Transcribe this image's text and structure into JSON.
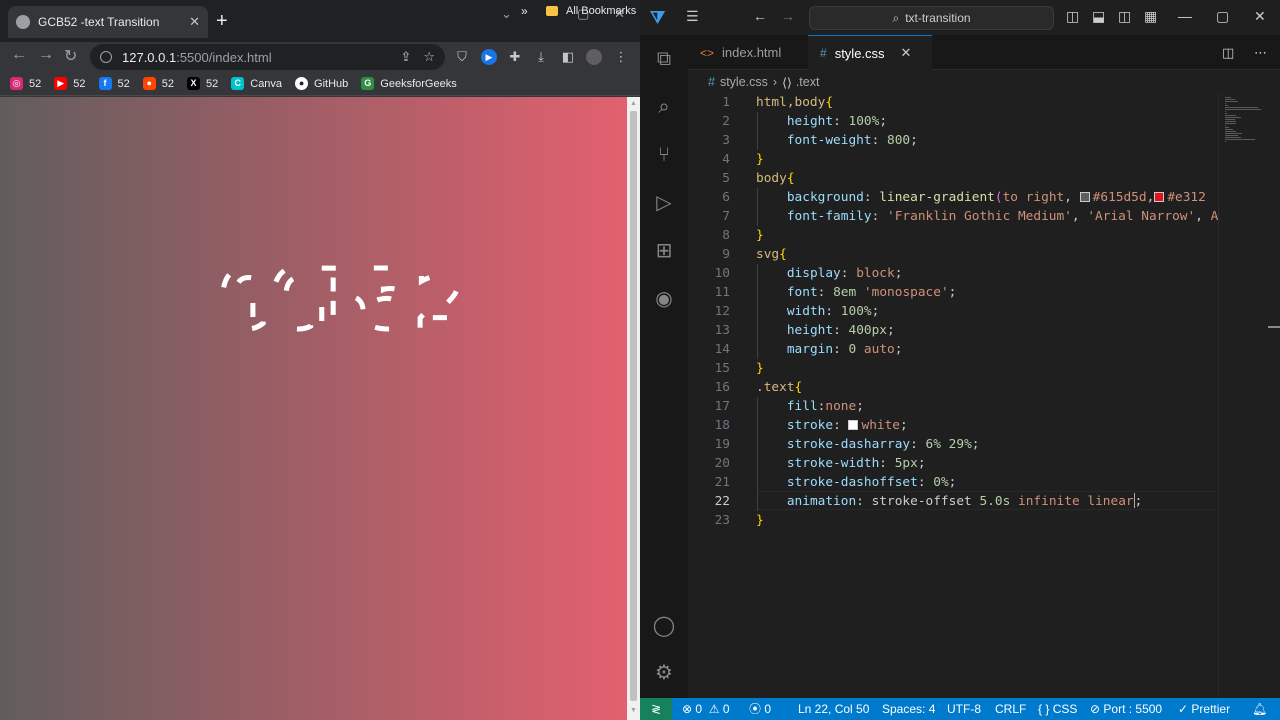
{
  "browser": {
    "tab_title": "GCB52 -text Transition",
    "url_host": "127.0.0.1",
    "url_rest": ":5500/index.html",
    "bookmarks": [
      {
        "icon": "instagram-icon",
        "label": "52",
        "color": "#d62976"
      },
      {
        "icon": "youtube-icon",
        "label": "52",
        "color": "#ff0000"
      },
      {
        "icon": "facebook-icon",
        "label": "52",
        "color": "#1877f2"
      },
      {
        "icon": "reddit-icon",
        "label": "52",
        "color": "#ff4500"
      },
      {
        "icon": "x-icon",
        "label": "52",
        "color": "#000000"
      },
      {
        "icon": "canva-icon",
        "label": "Canva",
        "color": "#00c4cc"
      },
      {
        "icon": "github-icon",
        "label": "GitHub",
        "color": "#ffffff"
      },
      {
        "icon": "geeksforgeeks-icon",
        "label": "GeeksforGeeks",
        "color": "#2f8d46"
      }
    ],
    "all_bookmarks": "All Bookmarks",
    "more_chevron": "»",
    "page_text": "GCB52",
    "gradient": [
      "#615d5d",
      "#e3606f"
    ]
  },
  "vscode": {
    "search_text": "txt-transition",
    "tabs": [
      {
        "icon": "<>",
        "label": "index.html",
        "active": false
      },
      {
        "icon": "#",
        "label": "style.css",
        "active": true
      }
    ],
    "breadcrumb": {
      "file": "style.css",
      "symbol": ".text"
    },
    "code": [
      [
        [
          "sel",
          "html,body"
        ],
        [
          "brace",
          "{"
        ]
      ],
      [
        [
          "plain",
          "    "
        ],
        [
          "prop",
          "height"
        ],
        [
          "plain",
          ": "
        ],
        [
          "num",
          "100%"
        ],
        [
          "plain",
          ";"
        ]
      ],
      [
        [
          "plain",
          "    "
        ],
        [
          "prop",
          "font-weight"
        ],
        [
          "plain",
          ": "
        ],
        [
          "num",
          "800"
        ],
        [
          "plain",
          ";"
        ]
      ],
      [
        [
          "brace",
          "}"
        ]
      ],
      [
        [
          "sel",
          "body"
        ],
        [
          "brace",
          "{"
        ]
      ],
      [
        [
          "plain",
          "    "
        ],
        [
          "prop",
          "background"
        ],
        [
          "plain",
          ": "
        ],
        [
          "fn",
          "linear-gradient"
        ],
        [
          "brace2",
          "("
        ],
        [
          "val",
          "to right"
        ],
        [
          "plain",
          ", "
        ],
        [
          "swatch",
          "#615d5d"
        ],
        [
          "val",
          "#615d5d"
        ],
        [
          "plain",
          ","
        ],
        [
          "swatch",
          "#e3121f"
        ],
        [
          "val",
          "#e312"
        ]
      ],
      [
        [
          "plain",
          "    "
        ],
        [
          "prop",
          "font-family"
        ],
        [
          "plain",
          ": "
        ],
        [
          "val",
          "'Franklin Gothic Medium'"
        ],
        [
          "plain",
          ", "
        ],
        [
          "val",
          "'Arial Narrow'"
        ],
        [
          "plain",
          ", "
        ],
        [
          "val",
          "A"
        ]
      ],
      [
        [
          "brace",
          "}"
        ]
      ],
      [
        [
          "sel",
          "svg"
        ],
        [
          "brace",
          "{"
        ]
      ],
      [
        [
          "plain",
          "    "
        ],
        [
          "prop",
          "display"
        ],
        [
          "plain",
          ": "
        ],
        [
          "val",
          "block"
        ],
        [
          "plain",
          ";"
        ]
      ],
      [
        [
          "plain",
          "    "
        ],
        [
          "prop",
          "font"
        ],
        [
          "plain",
          ": "
        ],
        [
          "num",
          "8em"
        ],
        [
          "plain",
          " "
        ],
        [
          "val",
          "'monospace'"
        ],
        [
          "plain",
          ";"
        ]
      ],
      [
        [
          "plain",
          "    "
        ],
        [
          "prop",
          "width"
        ],
        [
          "plain",
          ": "
        ],
        [
          "num",
          "100%"
        ],
        [
          "plain",
          ";"
        ]
      ],
      [
        [
          "plain",
          "    "
        ],
        [
          "prop",
          "height"
        ],
        [
          "plain",
          ": "
        ],
        [
          "num",
          "400px"
        ],
        [
          "plain",
          ";"
        ]
      ],
      [
        [
          "plain",
          "    "
        ],
        [
          "prop",
          "margin"
        ],
        [
          "plain",
          ": "
        ],
        [
          "num",
          "0"
        ],
        [
          "plain",
          " "
        ],
        [
          "val",
          "auto"
        ],
        [
          "plain",
          ";"
        ]
      ],
      [
        [
          "brace",
          "}"
        ]
      ],
      [
        [
          "sel",
          ".text"
        ],
        [
          "brace",
          "{"
        ]
      ],
      [
        [
          "plain",
          "    "
        ],
        [
          "prop",
          "fill"
        ],
        [
          "plain",
          ":"
        ],
        [
          "val",
          "none"
        ],
        [
          "plain",
          ";"
        ]
      ],
      [
        [
          "plain",
          "    "
        ],
        [
          "prop",
          "stroke"
        ],
        [
          "plain",
          ": "
        ],
        [
          "swatch",
          "#ffffff"
        ],
        [
          "val",
          "white"
        ],
        [
          "plain",
          ";"
        ]
      ],
      [
        [
          "plain",
          "    "
        ],
        [
          "prop",
          "stroke-dasharray"
        ],
        [
          "plain",
          ": "
        ],
        [
          "num",
          "6%"
        ],
        [
          "plain",
          " "
        ],
        [
          "num",
          "29%"
        ],
        [
          "plain",
          ";"
        ]
      ],
      [
        [
          "plain",
          "    "
        ],
        [
          "prop",
          "stroke-width"
        ],
        [
          "plain",
          ": "
        ],
        [
          "num",
          "5px"
        ],
        [
          "plain",
          ";"
        ]
      ],
      [
        [
          "plain",
          "    "
        ],
        [
          "prop",
          "stroke-dashoffset"
        ],
        [
          "plain",
          ": "
        ],
        [
          "num",
          "0%"
        ],
        [
          "plain",
          ";"
        ]
      ],
      [
        [
          "plain",
          "    "
        ],
        [
          "prop",
          "animation"
        ],
        [
          "plain",
          ": "
        ],
        [
          "plain",
          "stroke-offset "
        ],
        [
          "num",
          "5.0s"
        ],
        [
          "plain",
          " "
        ],
        [
          "val",
          "infinite"
        ],
        [
          "plain",
          " "
        ],
        [
          "val",
          "linear"
        ],
        [
          "caret",
          ""
        ],
        [
          "plain",
          ";"
        ]
      ],
      [
        [
          "brace",
          "}"
        ]
      ]
    ],
    "status": {
      "errors": "0",
      "warnings": "0",
      "ports": "0",
      "position": "Ln 22, Col 50",
      "spaces": "Spaces: 4",
      "encoding": "UTF-8",
      "eol": "CRLF",
      "language": "CSS",
      "port": "Port : 5500",
      "formatter": "Prettier"
    },
    "colors": {
      "accent": "#007acc",
      "remote": "#16825d"
    }
  }
}
